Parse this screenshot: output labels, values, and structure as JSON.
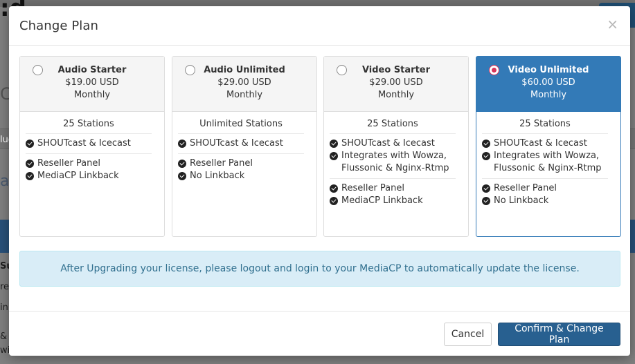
{
  "background": {
    "fragments": [
      "Su",
      "re",
      "in",
      "&",
      "wit",
      "lud",
      "C",
      "ar"
    ]
  },
  "modal": {
    "title": "Change Plan",
    "close_glyph": "×",
    "plans": [
      {
        "name": "Audio Starter",
        "price": "$19.00 USD",
        "period": "Monthly",
        "selected": false,
        "stations": "25 Stations",
        "groups": [
          [
            "SHOUTcast & Icecast"
          ],
          [
            "Reseller Panel",
            "MediaCP Linkback"
          ]
        ]
      },
      {
        "name": "Audio Unlimited",
        "price": "$29.00 USD",
        "period": "Monthly",
        "selected": false,
        "stations": "Unlimited Stations",
        "groups": [
          [
            "SHOUTcast & Icecast"
          ],
          [
            "Reseller Panel",
            "No Linkback"
          ]
        ]
      },
      {
        "name": "Video Starter",
        "price": "$29.00 USD",
        "period": "Monthly",
        "selected": false,
        "stations": "25 Stations",
        "groups": [
          [
            "SHOUTcast & Icecast",
            "Integrates with Wowza, Flussonic & Nginx-Rtmp"
          ],
          [
            "Reseller Panel",
            "MediaCP Linkback"
          ]
        ]
      },
      {
        "name": "Video Unlimited",
        "price": "$60.00 USD",
        "period": "Monthly",
        "selected": true,
        "stations": "25 Stations",
        "groups": [
          [
            "SHOUTcast & Icecast",
            "Integrates with Wowza, Flussonic & Nginx-Rtmp"
          ],
          [
            "Reseller Panel",
            "No Linkback"
          ]
        ]
      }
    ],
    "notice": "After Upgrading your license, please logout and login to your MediaCP to automatically update the license.",
    "buttons": {
      "cancel": "Cancel",
      "confirm": "Confirm & Change Plan"
    },
    "colors": {
      "selected_header": "#337ab7",
      "primary_button": "#286090",
      "notice_bg": "#d9edf7",
      "notice_text": "#31708f",
      "radio_selected": "#d9355a"
    }
  }
}
